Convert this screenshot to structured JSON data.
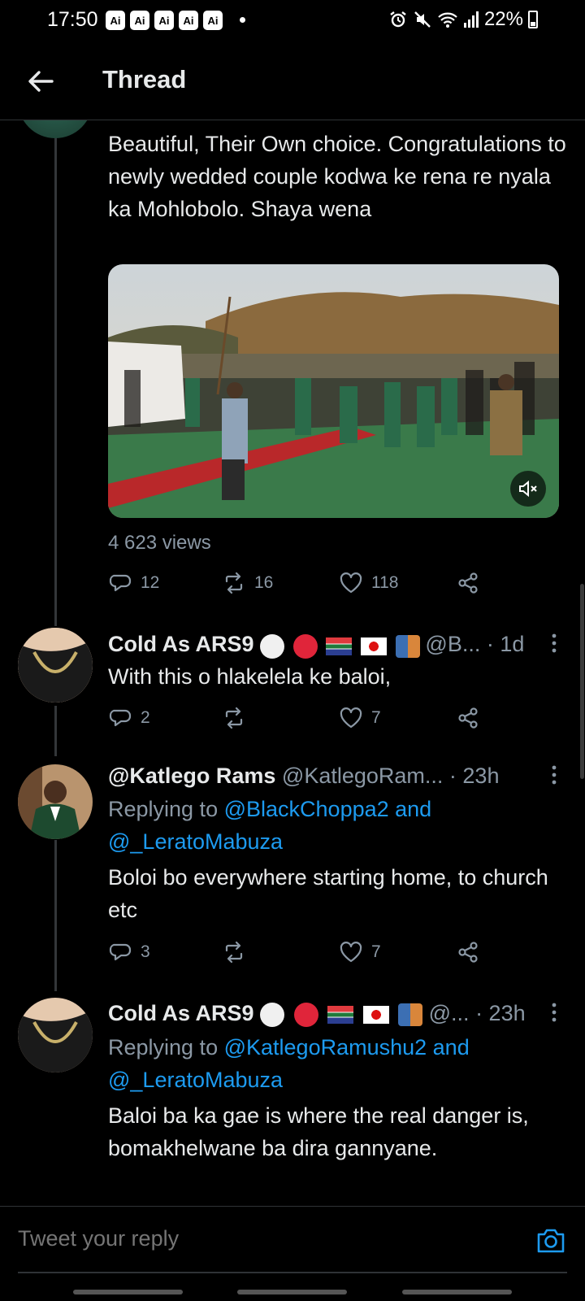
{
  "status_bar": {
    "time": "17:50",
    "ai_badges": [
      "Ai",
      "Ai",
      "Ai",
      "Ai",
      "Ai"
    ],
    "battery": "22%"
  },
  "header": {
    "title": "Thread"
  },
  "tweet_main": {
    "text": "Beautiful, Their Own choice. Congratulations to newly wedded couple kodwa ke rena re nyala ka Mohlobolo. Shaya wena",
    "views": "4 623 views",
    "replies": "12",
    "retweets": "16",
    "likes": "118"
  },
  "replies": [
    {
      "name": "Cold As ARS9",
      "handle": "@B...",
      "time": "· 1d",
      "text": "With this o hlakelela ke baloi,",
      "replies": "2",
      "retweets": "",
      "likes": "7"
    },
    {
      "name": "@Katlego Rams",
      "handle": "@KatlegoRam...",
      "time": "· 23h",
      "replying_prefix": "Replying to",
      "replying_to_1": "@BlackChoppa2 and",
      "replying_to_2": "@_LeratoMabuza",
      "text": "Boloi bo everywhere starting home, to church etc",
      "replies": "3",
      "retweets": "",
      "likes": "7"
    },
    {
      "name": "Cold As ARS9",
      "handle": "@...",
      "time": "· 23h",
      "replying_prefix": "Replying to",
      "replying_to_1": "@KatlegoRamushu2 and",
      "replying_to_2": "@_LeratoMabuza",
      "text": "Baloi ba ka gae is where the real danger is, bomakhelwane ba dira gannyane."
    }
  ],
  "composer": {
    "placeholder": "Tweet your reply"
  },
  "colors": {
    "background": "#000000",
    "text": "#e7e9ea",
    "secondary": "#8b98a5",
    "accent": "#1d9bf0"
  }
}
